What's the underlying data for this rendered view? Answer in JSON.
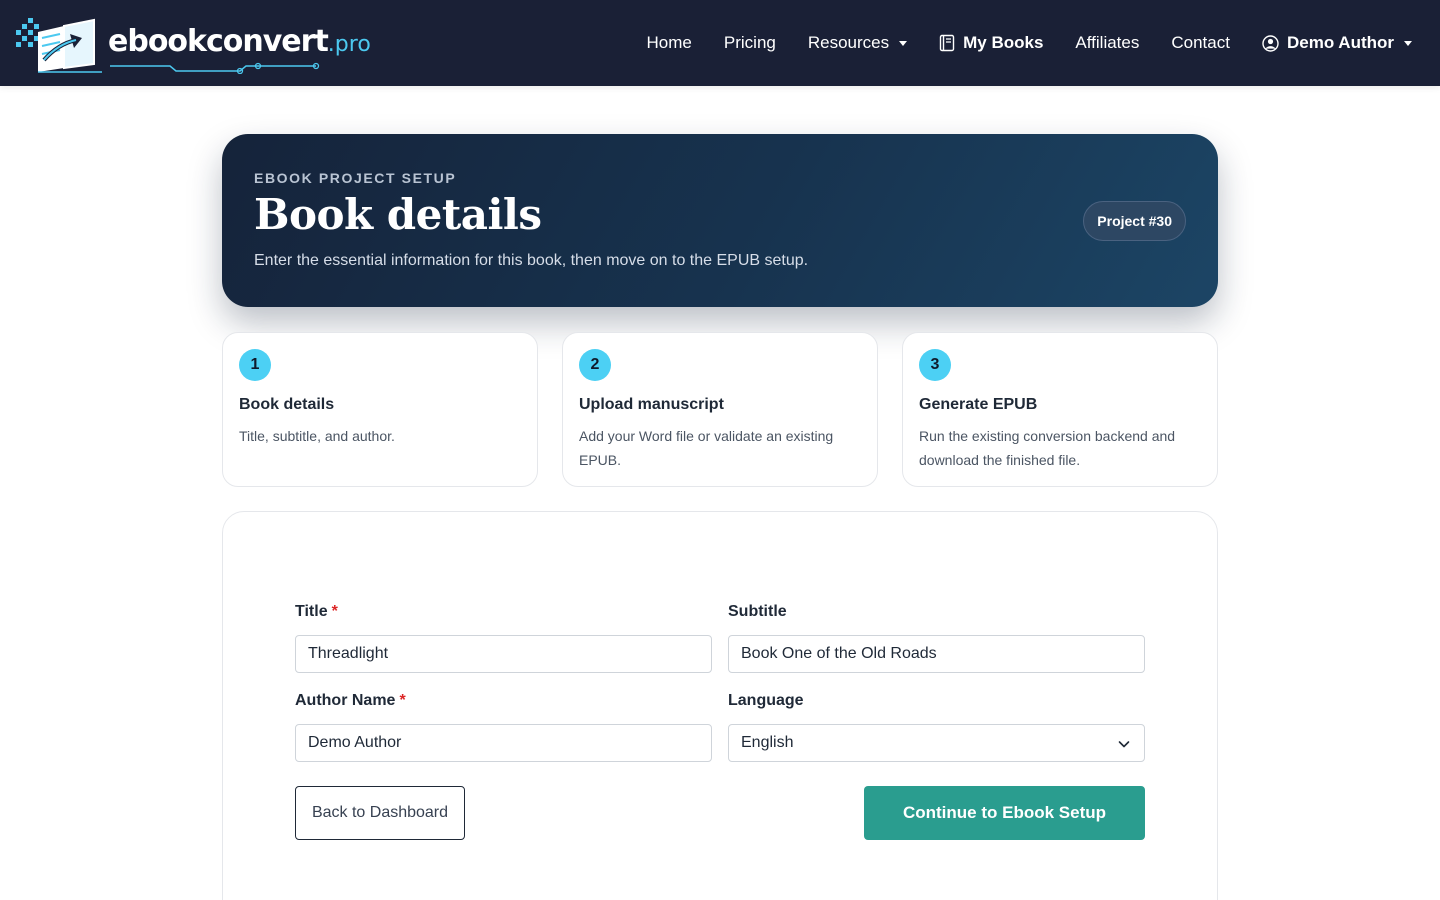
{
  "brand": {
    "name": "ebookconvert",
    "suffix": ".pro"
  },
  "nav": {
    "home": "Home",
    "pricing": "Pricing",
    "resources": "Resources",
    "my_books": "My Books",
    "affiliates": "Affiliates",
    "contact": "Contact",
    "user": "Demo Author"
  },
  "hero": {
    "kicker": "EBOOK PROJECT SETUP",
    "title": "Book details",
    "subtitle": "Enter the essential information for this book, then move on to the EPUB setup.",
    "badge": "Project #30"
  },
  "steps": [
    {
      "number": "1",
      "title": "Book details",
      "description": "Title, subtitle, and author."
    },
    {
      "number": "2",
      "title": "Upload manuscript",
      "description": "Add your Word file or validate an existing EPUB."
    },
    {
      "number": "3",
      "title": "Generate EPUB",
      "description": "Run the existing conversion backend and download the finished file."
    }
  ],
  "form": {
    "title_label": "Title",
    "title_value": "Threadlight",
    "subtitle_label": "Subtitle",
    "subtitle_value": "Book One of the Old Roads",
    "author_label": "Author Name",
    "author_value": "Demo Author",
    "language_label": "Language",
    "language_value": "English",
    "required_mark": "*",
    "back_label": "Back to Dashboard",
    "continue_label": "Continue to Ebook Setup"
  },
  "colors": {
    "navbar": "#1a2036",
    "accent": "#4cd0f4",
    "primary_button": "#2a9d8f",
    "required": "#dc2626"
  }
}
